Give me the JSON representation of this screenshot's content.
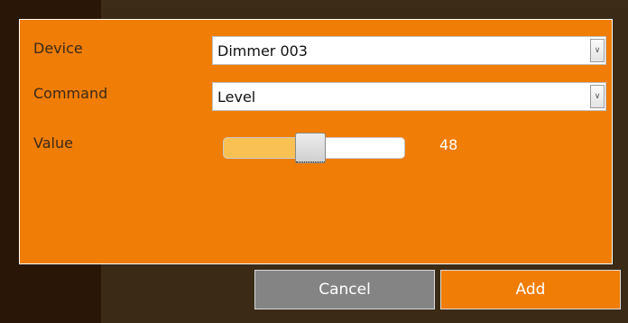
{
  "form": {
    "device_label": "Device",
    "command_label": "Command",
    "value_label": "Value",
    "device_select": {
      "selected": "Dimmer 003"
    },
    "command_select": {
      "selected": "Level"
    },
    "slider": {
      "value": "48",
      "fill_fraction": 0.48
    }
  },
  "buttons": {
    "cancel_label": "Cancel",
    "add_label": "Add"
  },
  "icons": {
    "dropdown": "chevron-down-icon"
  },
  "colors": {
    "panel": "#f07d05",
    "slider_fill": "#f9c153",
    "cancel_button": "#848484",
    "add_button": "#f07d05"
  }
}
